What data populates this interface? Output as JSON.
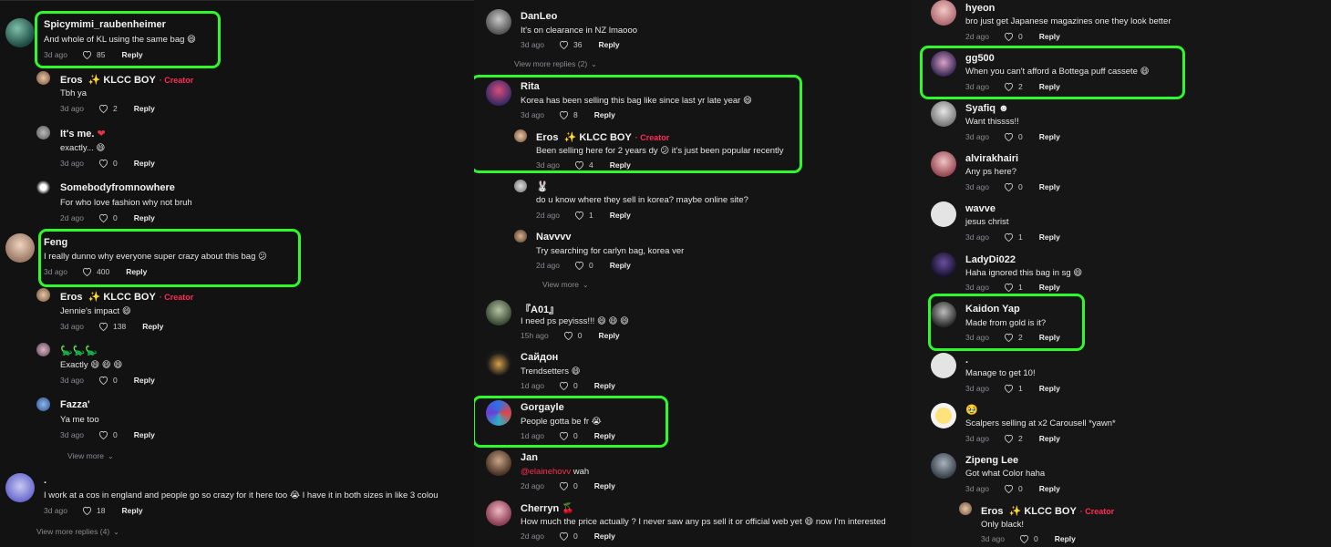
{
  "icons": {
    "like": "heart-outline-icon",
    "chevron": "chevron-down-icon",
    "sparkle": "sparkles-icon"
  },
  "colors": {
    "highlight": "#2ef92a",
    "creator": "#fe2c55",
    "meta": "#8a8b91"
  },
  "col1": {
    "c1": {
      "user": "Spicymimi_raubenheimer",
      "text": "And whole of KL using the same bag 😄",
      "time": "3d ago",
      "likes": "85",
      "reply": "Reply"
    },
    "c2": {
      "user": "Eros",
      "badge": "✨ KLCC BOY",
      "creator": "· Creator",
      "text": "Tbh ya",
      "time": "3d ago",
      "likes": "2",
      "reply": "Reply"
    },
    "c3": {
      "user": "It's me.",
      "heart": "❤",
      "text": "exactly... 😄",
      "time": "3d ago",
      "likes": "0",
      "reply": "Reply"
    },
    "c4": {
      "user": "Somebodyfromnowhere",
      "text": "For who love fashion why not bruh",
      "time": "2d ago",
      "likes": "0",
      "reply": "Reply"
    },
    "c5": {
      "user": "Feng",
      "text": "I really dunno why everyone super crazy about this bag 😕",
      "time": "3d ago",
      "likes": "400",
      "reply": "Reply"
    },
    "c6": {
      "user": "Eros",
      "badge": "✨ KLCC BOY",
      "creator": "· Creator",
      "text": "Jennie's impact 😄",
      "time": "3d ago",
      "likes": "138",
      "reply": "Reply"
    },
    "c7": {
      "user": "🦕🦕🦕",
      "text": "Exactly 😄 😄 😄",
      "time": "3d ago",
      "likes": "0",
      "reply": "Reply"
    },
    "c8": {
      "user": "Fazza'",
      "text": "Ya me too",
      "time": "3d ago",
      "likes": "0",
      "reply": "Reply"
    },
    "more1": "View more",
    "c9": {
      "user": ".",
      "text": "I work at a cos in england and people go so crazy for it here too 😭  I have it in both sizes in like 3 colou",
      "time": "3d ago",
      "likes": "18",
      "reply": "Reply"
    },
    "more2": "View more replies (4)"
  },
  "col2": {
    "c1": {
      "user": "DanLeo",
      "text": "It's on clearance in NZ lmaooo",
      "time": "3d ago",
      "likes": "36",
      "reply": "Reply"
    },
    "more1": "View more replies (2)",
    "c2": {
      "user": "Rita",
      "text": "Korea has been selling this bag like since last yr late year 😄",
      "time": "3d ago",
      "likes": "8",
      "reply": "Reply"
    },
    "c3": {
      "user": "Eros",
      "badge": "✨ KLCC BOY",
      "creator": "· Creator",
      "text": "Been selling here for 2 years dy 😕 it's just been popular recently",
      "time": "3d ago",
      "likes": "4",
      "reply": "Reply"
    },
    "c4": {
      "user": "🐰",
      "text": "do u know where they sell in korea? maybe online site?",
      "time": "2d ago",
      "likes": "1",
      "reply": "Reply"
    },
    "c5": {
      "user": "Navvvv",
      "text": "Try searching for carlyn bag, korea ver",
      "time": "2d ago",
      "likes": "0",
      "reply": "Reply"
    },
    "more2": "View more",
    "c6": {
      "user": "『A01』",
      "text": "I need ps peyisss!!! 😄 😄 😄",
      "time": "15h ago",
      "likes": "0",
      "reply": "Reply"
    },
    "c7": {
      "user": "Сайдон",
      "text": "Trendsetters 😄",
      "time": "1d ago",
      "likes": "0",
      "reply": "Reply"
    },
    "c8": {
      "user": "Gorgayle",
      "text": "People gotta be fr 😭",
      "time": "1d ago",
      "likes": "0",
      "reply": "Reply"
    },
    "c9": {
      "user": "Jan",
      "mention": "@elainehovv",
      "text": " wah",
      "time": "2d ago",
      "likes": "0",
      "reply": "Reply"
    },
    "c10": {
      "user": "Cherryn",
      "cherry": "🍒",
      "text": "How much the price actually ? I never saw any ps sell it or official web yet 😄  now I'm interested",
      "time": "2d ago",
      "likes": "0",
      "reply": "Reply"
    }
  },
  "col3": {
    "c1": {
      "user": "hyeon",
      "text": "bro just get Japanese magazines one they look better",
      "time": "2d ago",
      "likes": "0",
      "reply": "Reply"
    },
    "c2": {
      "user": "gg500",
      "text": "When you can't afford a Bottega puff cassete 😄",
      "time": "3d ago",
      "likes": "2",
      "reply": "Reply"
    },
    "c3": {
      "user": "Syafiq ☻",
      "text": "Want thissss!!",
      "time": "3d ago",
      "likes": "0",
      "reply": "Reply"
    },
    "c4": {
      "user": "alvirakhairi",
      "text": "Any ps here?",
      "time": "3d ago",
      "likes": "0",
      "reply": "Reply"
    },
    "c5": {
      "user": "wavve",
      "text": "jesus christ",
      "time": "3d ago",
      "likes": "1",
      "reply": "Reply"
    },
    "c6": {
      "user": "LadyDi022",
      "text": "Haha ignored this bag in sg 😄",
      "time": "3d ago",
      "likes": "1",
      "reply": "Reply"
    },
    "c7": {
      "user": "Kaidon Yap",
      "text": "Made from gold is it?",
      "time": "3d ago",
      "likes": "2",
      "reply": "Reply"
    },
    "c8": {
      "user": ".",
      "text": "Manage to get 10!",
      "time": "3d ago",
      "likes": "1",
      "reply": "Reply"
    },
    "c9": {
      "user": "🥹",
      "text": "Scalpers selling at x2 Carousell *yawn*",
      "time": "3d ago",
      "likes": "2",
      "reply": "Reply"
    },
    "c10": {
      "user": "Zipeng Lee",
      "text": "Got what Color haha",
      "time": "3d ago",
      "likes": "0",
      "reply": "Reply"
    },
    "c11": {
      "user": "Eros",
      "badge": "✨ KLCC BOY",
      "creator": "· Creator",
      "text": "Only black!",
      "time": "3d ago",
      "likes": "0",
      "reply": "Reply"
    }
  }
}
